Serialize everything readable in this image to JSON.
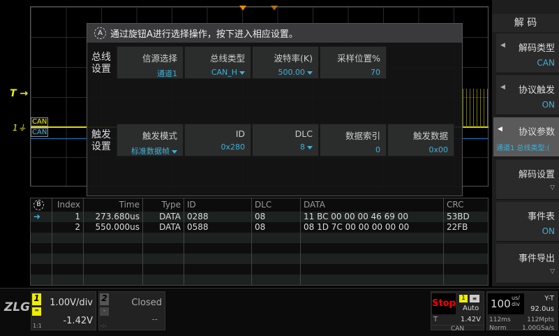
{
  "waveform": {
    "trigger_marker": "T",
    "channel_marker": "1",
    "decode_tag_top": "CAN",
    "decode_tag_bottom": "CAN",
    "colors": {
      "ch1": "#eeee00",
      "decode": "#1e7fd0",
      "trigger_pos": "#f08a00"
    }
  },
  "dialog": {
    "hint": "通过旋钮A进行选择操作，按下进入相应设置。",
    "knob": "A",
    "bus_group": "总线设置",
    "bus": [
      {
        "label": "信源选择",
        "value": "通道1",
        "dropdown": false
      },
      {
        "label": "总线类型",
        "value": "CAN_H",
        "dropdown": true
      },
      {
        "label": "波特率(K)",
        "value": "500.00",
        "dropdown": true
      },
      {
        "label": "采样位置%",
        "value": "70",
        "dropdown": false
      }
    ],
    "trig_group": "触发设置",
    "trig": [
      {
        "label": "触发模式",
        "value": "标准数据帧",
        "dropdown": true
      },
      {
        "label": "ID",
        "value": "0x280",
        "dropdown": false
      },
      {
        "label": "DLC",
        "value": "8",
        "dropdown": true
      },
      {
        "label": "数据索引",
        "value": "0",
        "dropdown": false
      },
      {
        "label": "触发数据",
        "value": "0x00",
        "dropdown": false
      }
    ]
  },
  "table": {
    "knob": "B",
    "headers": [
      "Index",
      "Time",
      "Type",
      "ID",
      "DLC",
      "DATA",
      "CRC"
    ],
    "rows": [
      [
        "1",
        "273.680us",
        "DATA",
        "0288",
        "08",
        "11 BC 00 00 00 46 69 00",
        "53BD"
      ],
      [
        "2",
        "550.000us",
        "DATA",
        "0588",
        "08",
        "08 1D 7C 00 00 00 00 00",
        "22FB"
      ]
    ]
  },
  "right_panel": {
    "title": "解 码",
    "buttons": [
      {
        "label": "解码类型",
        "value": "CAN"
      },
      {
        "label": "协议触发",
        "value": "ON"
      },
      {
        "label": "协议参数",
        "value": "通道1 总线类型:("
      },
      {
        "label": "解码设置",
        "value": ""
      },
      {
        "label": "事件表",
        "value": "ON"
      },
      {
        "label": "事件导出",
        "value": ""
      }
    ]
  },
  "bottom": {
    "logo": "ZLG",
    "ch1": {
      "num": "1",
      "scale": "1.00V/div",
      "offset": "-1.42V",
      "probe": "1:1"
    },
    "ch2": {
      "num": "2",
      "state": "Closed",
      "offset": "--",
      "coupling": "-",
      "probe": "-:-"
    },
    "run_state": "Stop",
    "trig_src": "1",
    "trig_mode": "Auto",
    "trig_label": "T",
    "trig_level": "1.42V",
    "trig_type": "CAN",
    "timebase": "100",
    "timebase_unit_top": "us/",
    "timebase_unit_bot": "div",
    "mode": "Y-T",
    "delay": "92.0us",
    "mem_time": "112ms",
    "mem_depth": "112Mpts",
    "acq": "Norm",
    "sample_rate": "1.00GSa/s"
  }
}
